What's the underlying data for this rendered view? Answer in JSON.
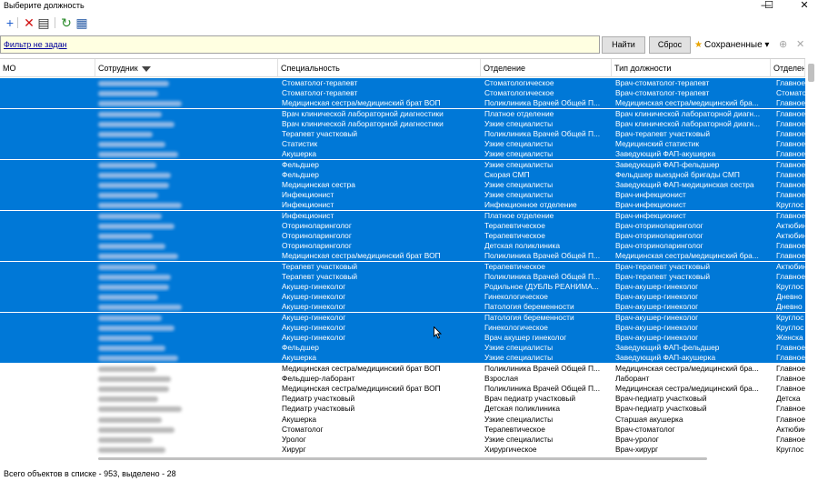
{
  "window": {
    "title": "Выберите должность",
    "minimize": "—",
    "maximize": "☐",
    "close": "✕"
  },
  "toolbar": [
    {
      "name": "add-icon",
      "glyph": "+",
      "color": "#1f5fcf"
    },
    {
      "name": "delete-icon",
      "glyph": "✕",
      "color": "#d01010"
    },
    {
      "name": "edit-icon",
      "glyph": "▤",
      "color": "#333333"
    },
    {
      "name": "refresh-icon",
      "glyph": "↻",
      "color": "#2a8a2a"
    },
    {
      "name": "export-icon",
      "glyph": "▦",
      "color": "#2d5fa8"
    }
  ],
  "filter": {
    "text": "Фильтр не задан",
    "find_label": "Найти",
    "reset_label": "Сброс",
    "saved_label": "Сохраненные",
    "saved_arrow": "▾",
    "dim1": "⊕",
    "dim2": "✕"
  },
  "columns": [
    {
      "key": "mo",
      "label": "МО"
    },
    {
      "key": "employee",
      "label": "Сотрудник"
    },
    {
      "key": "specialty",
      "label": "Специальность"
    },
    {
      "key": "department",
      "label": "Отделение"
    },
    {
      "key": "position",
      "label": "Тип должности"
    },
    {
      "key": "dept2",
      "label": "Отделен"
    }
  ],
  "rows": [
    {
      "sel": true,
      "specialty": "Стоматолог-терапевт",
      "department": "Стоматологическое",
      "position": "Врач-стоматолог-терапевт",
      "dept2": "Главное"
    },
    {
      "sel": true,
      "specialty": "Стоматолог-терапевт",
      "department": "Стоматологическое",
      "position": "Врач-стоматолог-терапевт",
      "dept2": "Стомато"
    },
    {
      "sel": true,
      "specialty": "Медицинская сестра/медицинский брат ВОП",
      "department": "Поликлиника Врачей Общей П...",
      "position": "Медицинская сестра/медицинский бра...",
      "dept2": "Главное"
    },
    {
      "sel": true,
      "specialty": "Врач клинической лабораторной диагностики",
      "department": "Платное отделение",
      "position": "Врач клинической лабораторной диагн...",
      "dept2": "Главное"
    },
    {
      "sel": true,
      "specialty": "Врач клинической лабораторной диагностики",
      "department": "Узкие специалисты",
      "position": "Врач клинической лабораторной диагн...",
      "dept2": "Главное"
    },
    {
      "sel": true,
      "specialty": "Терапевт участковый",
      "department": "Поликлиника Врачей Общей П...",
      "position": "Врач-терапевт участковый",
      "dept2": "Главное"
    },
    {
      "sel": true,
      "specialty": "Статистик",
      "department": "Узкие специалисты",
      "position": "Медицинский статистик",
      "dept2": "Главное"
    },
    {
      "sel": true,
      "specialty": "Акушерка",
      "department": "Узкие специалисты",
      "position": "Заведующий ФАП-акушерка",
      "dept2": "Главное"
    },
    {
      "sel": true,
      "specialty": "Фельдшер",
      "department": "Узкие специалисты",
      "position": "Заведующий ФАП-фельдшер",
      "dept2": "Главное"
    },
    {
      "sel": true,
      "specialty": "Фельдшер",
      "department": "Скорая СМП",
      "position": "Фельдшер выездной бригады СМП",
      "dept2": "Главное"
    },
    {
      "sel": true,
      "specialty": "Медицинская сестра",
      "department": "Узкие специалисты",
      "position": "Заведующий ФАП-медицинская сестра",
      "dept2": "Главное"
    },
    {
      "sel": true,
      "specialty": "Инфекционист",
      "department": "Узкие специалисты",
      "position": "Врач-инфекционист",
      "dept2": "Главное"
    },
    {
      "sel": true,
      "specialty": "Инфекционист",
      "department": "Инфекционное отделение",
      "position": "Врач-инфекционист",
      "dept2": "Круглос"
    },
    {
      "sel": true,
      "specialty": "Инфекционист",
      "department": "Платное отделение",
      "position": "Врач-инфекционист",
      "dept2": "Главное"
    },
    {
      "sel": true,
      "specialty": "Оториноларинголог",
      "department": "Терапевтическое",
      "position": "Врач-оториноларинголог",
      "dept2": "Актюбин"
    },
    {
      "sel": true,
      "specialty": "Оториноларинголог",
      "department": "Терапевтическое",
      "position": "Врач-оториноларинголог",
      "dept2": "Актюбин"
    },
    {
      "sel": true,
      "specialty": "Оториноларинголог",
      "department": "Детская поликлиника",
      "position": "Врач-оториноларинголог",
      "dept2": "Главное"
    },
    {
      "sel": true,
      "specialty": "Медицинская сестра/медицинский брат ВОП",
      "department": "Поликлиника Врачей Общей П...",
      "position": "Медицинская сестра/медицинский бра...",
      "dept2": "Главное"
    },
    {
      "sel": true,
      "specialty": "Терапевт участковый",
      "department": "Терапевтическое",
      "position": "Врач-терапевт участковый",
      "dept2": "Актюбин"
    },
    {
      "sel": true,
      "specialty": "Терапевт участковый",
      "department": "Поликлиника Врачей Общей П...",
      "position": "Врач-терапевт участковый",
      "dept2": "Главное"
    },
    {
      "sel": true,
      "specialty": "Акушер-гинеколог",
      "department": "Родильное (ДУБЛЬ РЕАНИМА...",
      "position": "Врач-акушер-гинеколог",
      "dept2": "Круглос"
    },
    {
      "sel": true,
      "specialty": "Акушер-гинеколог",
      "department": "Гинекологическое",
      "position": "Врач-акушер-гинеколог",
      "dept2": "Дневно"
    },
    {
      "sel": true,
      "specialty": "Акушер-гинеколог",
      "department": "Патология беременности",
      "position": "Врач-акушер-гинеколог",
      "dept2": "Дневно"
    },
    {
      "sel": true,
      "specialty": "Акушер-гинеколог",
      "department": "Патология беременности",
      "position": "Врач-акушер-гинеколог",
      "dept2": "Круглос"
    },
    {
      "sel": true,
      "specialty": "Акушер-гинеколог",
      "department": "Гинекологическое",
      "position": "Врач-акушер-гинеколог",
      "dept2": "Круглос"
    },
    {
      "sel": true,
      "specialty": "Акушер-гинеколог",
      "department": "Врач акушер гинеколог",
      "position": "Врач-акушер-гинеколог",
      "dept2": "Женска"
    },
    {
      "sel": true,
      "specialty": "Фельдшер",
      "department": "Узкие специалисты",
      "position": "Заведующий ФАП-фельдшер",
      "dept2": "Главное"
    },
    {
      "sel": true,
      "specialty": "Акушерка",
      "department": "Узкие специалисты",
      "position": "Заведующий ФАП-акушерка",
      "dept2": "Главное"
    },
    {
      "sel": false,
      "specialty": "Медицинская сестра/медицинский брат ВОП",
      "department": "Поликлиника Врачей Общей П...",
      "position": "Медицинская сестра/медицинский бра...",
      "dept2": "Главное"
    },
    {
      "sel": false,
      "specialty": "Фельдшер-лаборант",
      "department": "Взрослая",
      "position": "Лаборант",
      "dept2": "Главное"
    },
    {
      "sel": false,
      "specialty": "Медицинская сестра/медицинский брат ВОП",
      "department": "Поликлиника Врачей Общей П...",
      "position": "Медицинская сестра/медицинский бра...",
      "dept2": "Главное"
    },
    {
      "sel": false,
      "specialty": "Педиатр участковый",
      "department": "Врач педиатр участковый",
      "position": "Врач-педиатр участковый",
      "dept2": "Детска"
    },
    {
      "sel": false,
      "specialty": "Педиатр участковый",
      "department": "Детская поликлиника",
      "position": "Врач-педиатр участковый",
      "dept2": "Главное"
    },
    {
      "sel": false,
      "specialty": "Акушерка",
      "department": "Узкие специалисты",
      "position": "Старшая акушерка",
      "dept2": "Главное"
    },
    {
      "sel": false,
      "specialty": "Стоматолог",
      "department": "Терапевтическое",
      "position": "Врач-стоматолог",
      "dept2": "Актюбин"
    },
    {
      "sel": false,
      "specialty": "Уролог",
      "department": "Узкие специалисты",
      "position": "Врач-уролог",
      "dept2": "Главное"
    },
    {
      "sel": false,
      "specialty": "Хирург",
      "department": "Хирургическое",
      "position": "Врач-хирург",
      "dept2": "Круглос"
    }
  ],
  "status": {
    "text": "Всего объектов в списке - 953, выделено - 28"
  },
  "colors": {
    "selection": "#0078d7",
    "filter_bg": "#ffffe1",
    "link": "#00009b"
  }
}
